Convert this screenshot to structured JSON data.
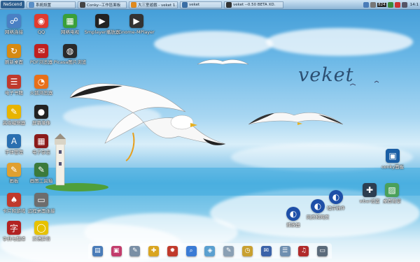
{
  "taskbar": {
    "start_label": "NeScend",
    "windows": [
      {
        "label": "系統設置",
        "icon": "folder-icon",
        "color": "#5a8fc7"
      },
      {
        "label": "Conky--工作區面板",
        "icon": "terminal-icon",
        "color": "#444"
      },
      {
        "label": "大三室遊戲 - veket 1.",
        "icon": "game-icon",
        "color": "#e08a1e"
      },
      {
        "label": "veket",
        "icon": "desktop-icon",
        "color": "#3a6ea5"
      },
      {
        "label": "veket --0.50 BETA XD.",
        "icon": "terminal-icon",
        "color": "#333"
      }
    ],
    "tray": {
      "battery": "824",
      "clock": "14:1"
    }
  },
  "desktop": {
    "brand_text": "veket",
    "icons_left": [
      {
        "label": "网络连接",
        "icon": "network-icon",
        "color": "#4a80c4"
      },
      {
        "label": "QQ",
        "icon": "qq-icon",
        "color": "#e03b2f"
      },
      {
        "label": "网络电视",
        "icon": "tv-icon",
        "color": "#3aa03a"
      },
      {
        "label": "Smplayer播放器",
        "icon": "smplayer-icon",
        "color": "#222"
      },
      {
        "label": "Gnome-MPlayer",
        "icon": "mplayer-icon",
        "color": "#333"
      },
      {
        "label": "刷新桌面",
        "icon": "refresh-icon",
        "color": "#d68a12"
      },
      {
        "label": "PDF浏览器",
        "icon": "pdf-icon",
        "color": "#c02020"
      },
      {
        "label": "Picasa图片浏览",
        "icon": "camera-icon",
        "color": "#2a2a2a"
      },
      {
        "label": "电子书籍",
        "icon": "book-icon",
        "color": "#c0392b"
      },
      {
        "label": "火狐浏览器",
        "icon": "firefox-icon",
        "color": "#e8701a"
      },
      {
        "label": "高级编辑器",
        "icon": "editor-icon",
        "color": "#e8b400"
      },
      {
        "label": "屏幕录像",
        "icon": "record-icon",
        "color": "#222"
      },
      {
        "label": "字体管理",
        "icon": "font-icon",
        "color": "#2a6fb0"
      },
      {
        "label": "电子杂志",
        "icon": "magazine-icon",
        "color": "#8b1a1a"
      },
      {
        "label": "画板",
        "icon": "paint-icon",
        "color": "#e0a030"
      },
      {
        "label": "画图工具箱",
        "icon": "draw-icon",
        "color": "#3b7a3b"
      },
      {
        "label": "卡片和游戏",
        "icon": "cards-icon",
        "color": "#c0392b"
      },
      {
        "label": "远程桌面连接",
        "icon": "remote-icon",
        "color": "#6d6d6d"
      },
      {
        "label": "字典与翻译",
        "icon": "dictionary-icon",
        "color": "#b22222"
      },
      {
        "label": "汉语拼音",
        "icon": "pinyin-icon",
        "color": "#e6c200"
      }
    ],
    "icons_right": [
      {
        "label": "conky面板",
        "icon": "conky-icon",
        "color": "#1b5fa5"
      },
      {
        "label": "wbar设置",
        "icon": "wbar-settings-icon",
        "color": "#2d3e50"
      },
      {
        "label": "桌面背景",
        "icon": "wallpaper-icon",
        "color": "#4aa05a"
      },
      {
        "label": "网页和网页",
        "icon": "web-icon",
        "color": "#1e4fa8"
      },
      {
        "label": "程序插件",
        "icon": "plugin-icon",
        "color": "#1e4fa8"
      },
      {
        "label": "播放器",
        "icon": "player-icon",
        "color": "#1e4fa8"
      }
    ]
  },
  "dock": [
    {
      "icon": "folder-icon",
      "color": "#4a7cb8",
      "glyph": "▤"
    },
    {
      "icon": "terminal-icon",
      "color": "#c23b6b",
      "glyph": "▣"
    },
    {
      "icon": "edit-icon",
      "color": "#7a8fa5",
      "glyph": "✎"
    },
    {
      "icon": "tools-icon",
      "color": "#d9a520",
      "glyph": "✚"
    },
    {
      "icon": "paint-icon",
      "color": "#c0392b",
      "glyph": "✹"
    },
    {
      "icon": "search-icon",
      "color": "#3a7bd5",
      "glyph": "⌕"
    },
    {
      "icon": "image-icon",
      "color": "#5aa0d0",
      "glyph": "◈"
    },
    {
      "icon": "text-icon",
      "color": "#8aa0b4",
      "glyph": "✎"
    },
    {
      "icon": "clock-icon",
      "color": "#c8a030",
      "glyph": "◷"
    },
    {
      "icon": "mail-icon",
      "color": "#3a62a8",
      "glyph": "✉"
    },
    {
      "icon": "notes-icon",
      "color": "#6f8fb0",
      "glyph": "☰"
    },
    {
      "icon": "music-icon",
      "color": "#b02a2a",
      "glyph": "♫"
    },
    {
      "icon": "display-icon",
      "color": "#5a6a7a",
      "glyph": "▭"
    }
  ]
}
